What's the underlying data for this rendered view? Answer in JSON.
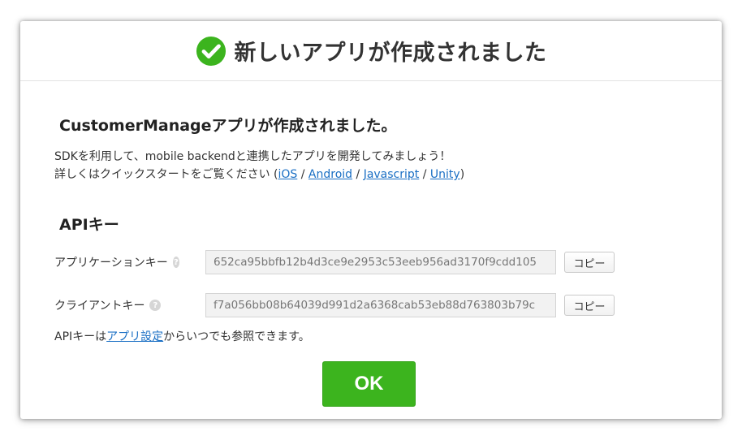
{
  "header": {
    "title": "新しいアプリが作成されました",
    "icon": "check-circle-icon",
    "icon_color": "#3cb41e"
  },
  "content": {
    "app_created_heading": "CustomerManageアプリが作成されました。",
    "description_line1": "SDKを利用して、mobile backendと連携したアプリを開発してみましょう！",
    "description_line2_prefix": "詳しくはクイックスタートをご覧ください (",
    "links": [
      "iOS",
      "Android",
      "Javascript",
      "Unity"
    ],
    "separator": " / ",
    "description_line2_suffix": ")"
  },
  "api_keys": {
    "heading": "APIキー",
    "application_key": {
      "label": "アプリケーションキー",
      "value": "652ca95bbfb12b4d3ce9e2953c53eeb956ad3170f9cdd105",
      "copy_label": "コピー"
    },
    "client_key": {
      "label": "クライアントキー",
      "value": "f7a056bb08b64039d991d2a6368cab53eb88d763803b79c",
      "copy_label": "コピー"
    },
    "help_glyph": "?",
    "note_prefix": "APIキーは",
    "note_link": "アプリ設定",
    "note_suffix": "からいつでも参照できます。"
  },
  "footer": {
    "ok_label": "OK",
    "ok_color": "#3cb41e"
  },
  "colors": {
    "link": "#1a6fc4",
    "accent_green": "#3cb41e"
  }
}
